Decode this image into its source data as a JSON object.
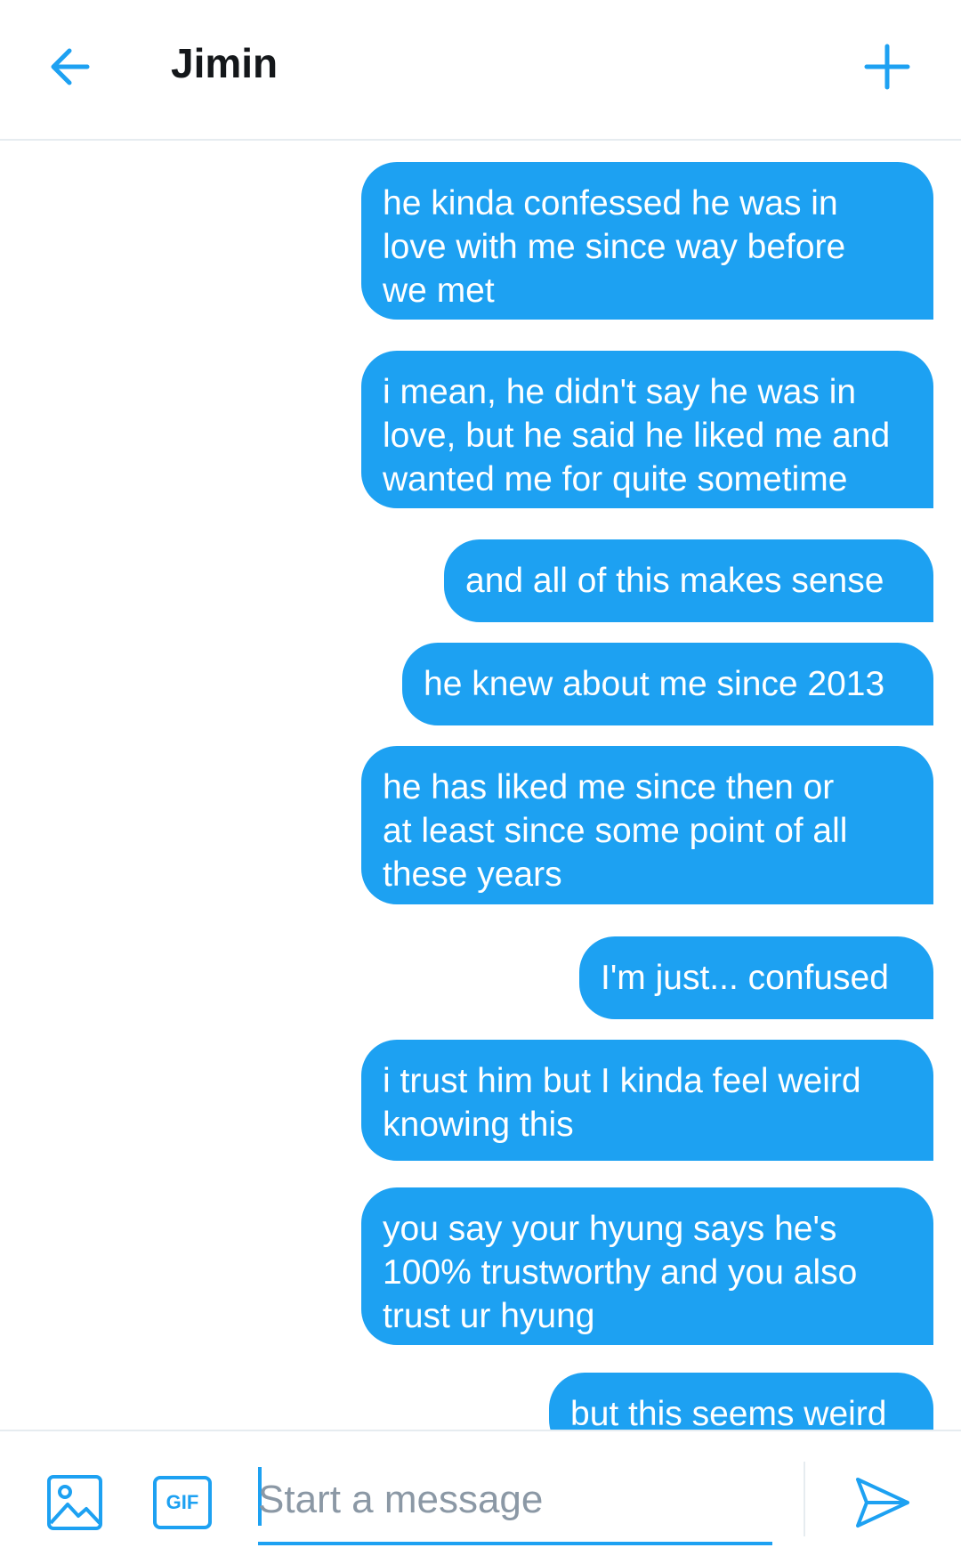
{
  "header": {
    "title": "Jimin",
    "back_icon": "arrow-left-icon",
    "new_icon": "plus-icon"
  },
  "messages": [
    {
      "text": "he kinda confessed he was in\nlove with me since way before\nwe met"
    },
    {
      "text": "i mean, he didn't say he was in\nlove, but he said he liked me and\nwanted me for quite sometime"
    },
    {
      "text": "and all of this makes sense"
    },
    {
      "text": "he knew about me since 2013"
    },
    {
      "text": "he has liked me since then or\nat least since some point of all\nthese years"
    },
    {
      "text": "I'm just... confused"
    },
    {
      "text": "i trust him but I kinda feel weird\nknowing this"
    },
    {
      "text": "you say your hyung says he's\n100% trustworthy and you also\ntrust ur hyung"
    },
    {
      "text": "but this seems weird"
    }
  ],
  "composer": {
    "placeholder": "Start a message",
    "gif_label": "GIF",
    "image_icon": "image-icon",
    "send_icon": "send-icon"
  },
  "colors": {
    "accent": "#1da1f2",
    "bubble_text": "#ffffff",
    "title_text": "#14171a",
    "placeholder": "#8b98a5",
    "divider": "#e6ecf0"
  }
}
